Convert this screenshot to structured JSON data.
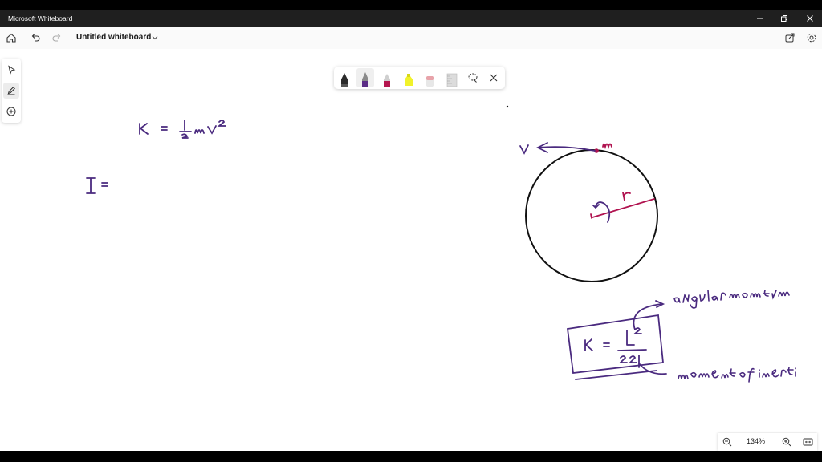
{
  "window": {
    "title": "Microsoft Whiteboard"
  },
  "toolbar": {
    "doc_title": "Untitled whiteboard"
  },
  "left_tools": [
    "select-icon",
    "pen-icon",
    "add-icon"
  ],
  "pen_tray": {
    "tools": [
      "black-pen",
      "purple-pen",
      "magenta-pen",
      "yellow-highlighter",
      "eraser",
      "ruler"
    ],
    "selected": "purple-pen",
    "colors": {
      "black": "#1a1a1a",
      "purple": "#5b2d86",
      "magenta": "#b5164f",
      "yellow": "#f1f22a",
      "eraser": "#e8a3aa"
    }
  },
  "zoom": {
    "level": "134%"
  },
  "ink_colors": {
    "purple": "#4a2a7f",
    "magenta": "#b0124f",
    "black": "#111111"
  },
  "handwriting": {
    "kinetic_formula": "K = ½ m v²",
    "inertia_partial": "I =",
    "velocity_label": "v",
    "mass_label": "m",
    "radius_label": "r",
    "boxed_formula": "K = L² / 2I",
    "annotation_angular": "angular momentum",
    "annotation_inertia": "moment of inertia"
  }
}
